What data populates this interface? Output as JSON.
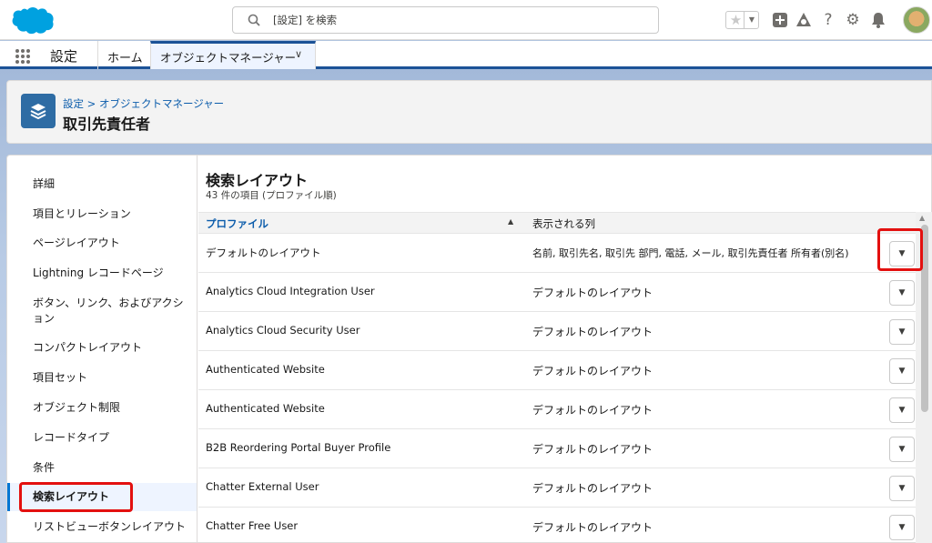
{
  "header": {
    "search_placeholder": "[設定] を検索"
  },
  "nav": {
    "app_name": "設定",
    "home": "ホーム",
    "active_tab": "オブジェクトマネージャー"
  },
  "page_header": {
    "breadcrumb": "設定 > オブジェクトマネージャー",
    "title": "取引先責任者"
  },
  "sidebar": {
    "items": [
      {
        "label": "詳細"
      },
      {
        "label": "項目とリレーション"
      },
      {
        "label": "ページレイアウト"
      },
      {
        "label": "Lightning レコードページ"
      },
      {
        "label": "ボタン、リンク、およびアクション"
      },
      {
        "label": "コンパクトレイアウト"
      },
      {
        "label": "項目セット"
      },
      {
        "label": "オブジェクト制限"
      },
      {
        "label": "レコードタイプ"
      },
      {
        "label": "条件"
      },
      {
        "label": "検索レイアウト"
      },
      {
        "label": "リストビューボタンレイアウト"
      }
    ],
    "active": "検索レイアウト"
  },
  "content": {
    "title": "検索レイアウト",
    "subtitle": "43 件の項目 (プロファイル順)",
    "columns": [
      "プロファイル",
      "表示される列"
    ],
    "rows": [
      {
        "profile": "デフォルトのレイアウト",
        "columns": "名前, 取引先名, 取引先 部門, 電話, メール, 取引先責任者 所有者(別名)"
      },
      {
        "profile": "Analytics Cloud Integration User",
        "columns": "デフォルトのレイアウト"
      },
      {
        "profile": "Analytics Cloud Security User",
        "columns": "デフォルトのレイアウト"
      },
      {
        "profile": "Authenticated Website",
        "columns": "デフォルトのレイアウト"
      },
      {
        "profile": "Authenticated Website",
        "columns": "デフォルトのレイアウト"
      },
      {
        "profile": "B2B Reordering Portal Buyer Profile",
        "columns": "デフォルトのレイアウト"
      },
      {
        "profile": "Chatter External User",
        "columns": "デフォルトのレイアウト"
      },
      {
        "profile": "Chatter Free User",
        "columns": "デフォルトのレイアウト"
      }
    ]
  },
  "colors": {
    "brand_blue": "#0176d3",
    "highlight_red": "#e3100f",
    "link_blue": "#0b5cab"
  }
}
